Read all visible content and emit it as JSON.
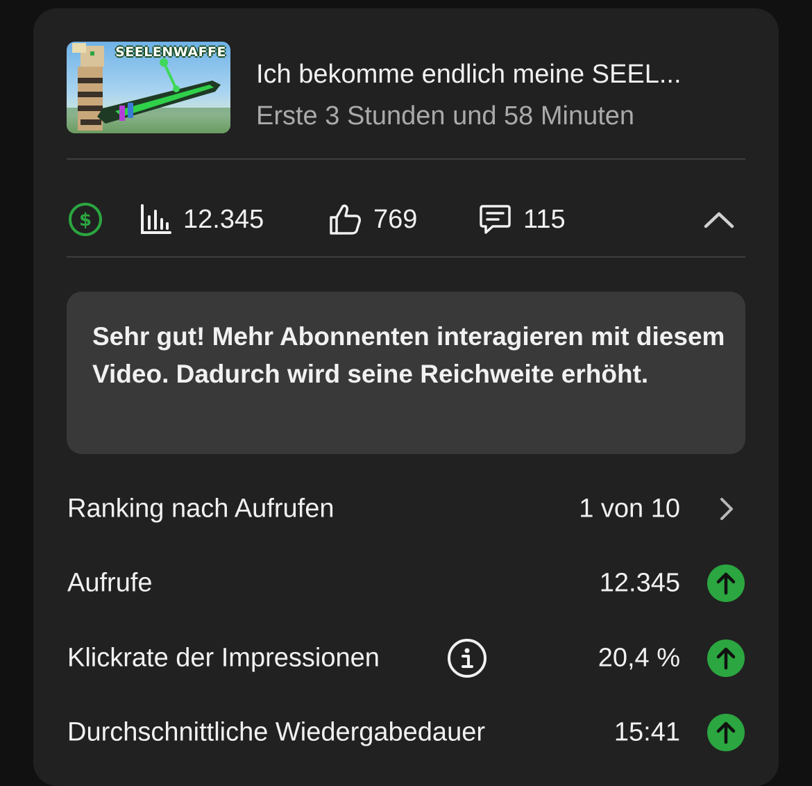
{
  "video": {
    "thumbnail_text": "SEELENWAFFE",
    "title": "Ich bekomme endlich meine SEEL...",
    "subtitle": "Erste 3 Stunden und 58 Minuten"
  },
  "stats": {
    "monetization_icon": "dollar-circle-icon",
    "views": "12.345",
    "likes": "769",
    "comments": "115"
  },
  "info_message": "Sehr gut! Mehr Abonnenten interagieren mit diesem Video. Dadurch wird seine Reichweite erhöht.",
  "metrics": [
    {
      "label": "Ranking nach Aufrufen",
      "value": "1 von 10",
      "icon": "chevron-right-icon"
    },
    {
      "label": "Aufrufe",
      "value": "12.345",
      "icon": "arrow-up-icon"
    },
    {
      "label": "Klickrate der Impressionen",
      "value": "20,4 %",
      "icon": "arrow-up-icon"
    },
    {
      "label": "Durchschnittliche Wiedergabedauer",
      "value": "15:41",
      "icon": "arrow-up-icon"
    }
  ],
  "colors": {
    "card_background": "#212121",
    "info_box_background": "#393939",
    "positive_green": "#2ba640",
    "secondary_text": "#aaaaaa"
  }
}
